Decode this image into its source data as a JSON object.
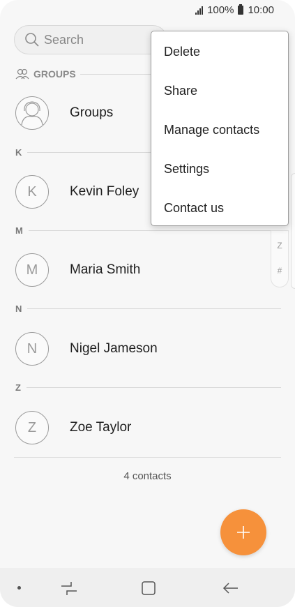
{
  "status_bar": {
    "battery": "100%",
    "time": "10:00"
  },
  "search": {
    "placeholder": "Search"
  },
  "groups_header": {
    "label": "GROUPS"
  },
  "groups_row": {
    "name": "Groups"
  },
  "sections": [
    {
      "letter": "K",
      "contacts": [
        {
          "initial": "K",
          "name": "Kevin Foley"
        }
      ]
    },
    {
      "letter": "M",
      "contacts": [
        {
          "initial": "M",
          "name": "Maria Smith"
        }
      ]
    },
    {
      "letter": "N",
      "contacts": [
        {
          "initial": "N",
          "name": "Nigel Jameson"
        }
      ]
    },
    {
      "letter": "Z",
      "contacts": [
        {
          "initial": "Z",
          "name": "Zoe Taylor"
        }
      ]
    }
  ],
  "contact_count": "4 contacts",
  "index_scroller": [
    "Z",
    "#"
  ],
  "menu": {
    "items": [
      "Delete",
      "Share",
      "Manage contacts",
      "Settings",
      "Contact us"
    ]
  },
  "colors": {
    "accent": "#f6913b"
  },
  "icons": {
    "search": "search-icon",
    "groups": "groups-icon",
    "add": "plus-icon",
    "recent_apps": "recent-apps-icon",
    "home": "home-icon",
    "back": "back-icon"
  }
}
